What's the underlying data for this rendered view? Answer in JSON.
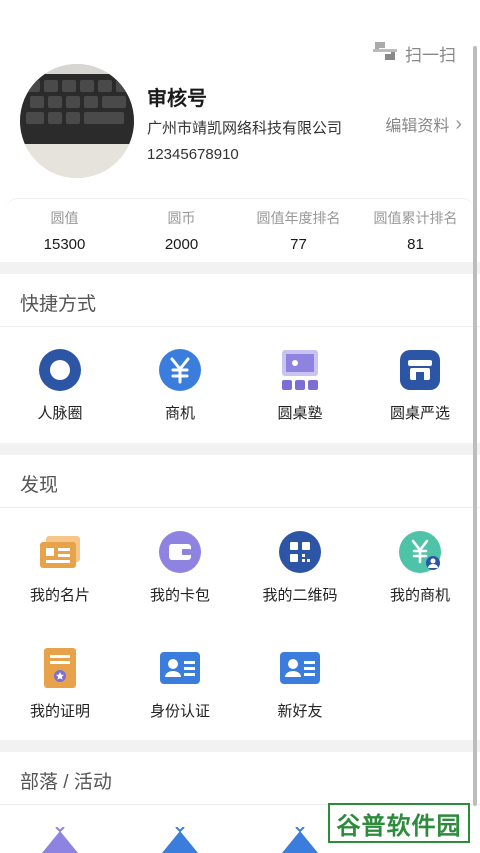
{
  "header": {
    "scan_label": "扫一扫"
  },
  "profile": {
    "name": "审核号",
    "company": "广州市靖凯网络科技有限公司",
    "phone": "12345678910",
    "edit_label": "编辑资料"
  },
  "stats": [
    {
      "label": "圆值",
      "value": "15300"
    },
    {
      "label": "圆币",
      "value": "2000"
    },
    {
      "label": "圆值年度排名",
      "value": "77"
    },
    {
      "label": "圆值累计排名",
      "value": "81"
    }
  ],
  "shortcuts": {
    "title": "快捷方式",
    "items": [
      {
        "label": "人脉圈",
        "icon": "network-circle-icon"
      },
      {
        "label": "商机",
        "icon": "yen-icon"
      },
      {
        "label": "圆桌塾",
        "icon": "classroom-icon"
      },
      {
        "label": "圆桌严选",
        "icon": "store-icon"
      }
    ]
  },
  "discover": {
    "title": "发现",
    "items": [
      {
        "label": "我的名片",
        "icon": "business-card-icon"
      },
      {
        "label": "我的卡包",
        "icon": "wallet-icon"
      },
      {
        "label": "我的二维码",
        "icon": "qr-code-icon"
      },
      {
        "label": "我的商机",
        "icon": "my-opportunity-icon"
      },
      {
        "label": "我的证明",
        "icon": "certificate-icon"
      },
      {
        "label": "身份认证",
        "icon": "id-card-icon"
      },
      {
        "label": "新好友",
        "icon": "new-friend-icon"
      }
    ]
  },
  "tribe": {
    "title": "部落 / 活动"
  },
  "watermark": "谷普软件园",
  "colors": {
    "primary": "#2d55a6",
    "blue": "#3b7ddd",
    "orange": "#e8a24a",
    "purple": "#7b6fd6",
    "teal": "#4fc3a8"
  }
}
